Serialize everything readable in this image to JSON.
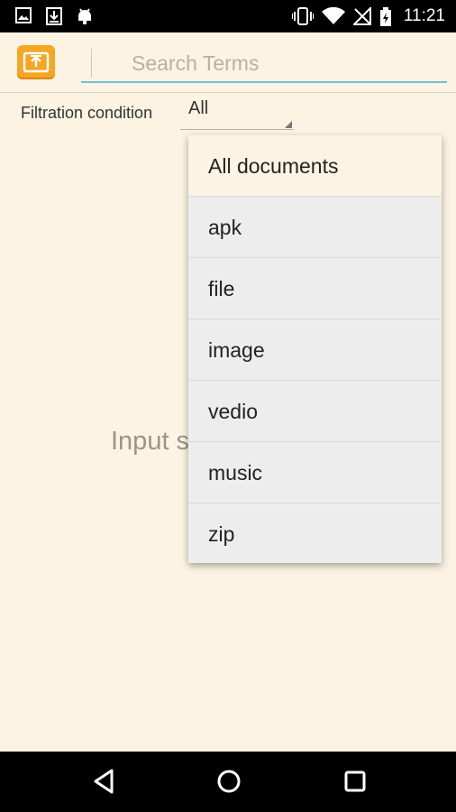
{
  "status_bar": {
    "time": "11:21",
    "left_icons": [
      "image-icon",
      "download-icon",
      "android-debug-icon"
    ],
    "right_icons": [
      "vibrate-icon",
      "wifi-icon",
      "no-signal-icon",
      "battery-charging-icon"
    ]
  },
  "toolbar": {
    "app_icon": "folder-upload-icon",
    "search": {
      "placeholder": "Search Terms",
      "value": ""
    }
  },
  "filter": {
    "label": "Filtration condition",
    "selected": "All"
  },
  "empty_hint": "Input s",
  "dropdown": {
    "items": [
      {
        "label": "All documents",
        "selected": true
      },
      {
        "label": "apk",
        "selected": false
      },
      {
        "label": "file",
        "selected": false
      },
      {
        "label": "image",
        "selected": false
      },
      {
        "label": "vedio",
        "selected": false
      },
      {
        "label": "music",
        "selected": false
      },
      {
        "label": "zip",
        "selected": false
      }
    ]
  },
  "nav_bar": {
    "buttons": [
      "back-icon",
      "home-icon",
      "recents-icon"
    ]
  },
  "colors": {
    "background": "#FCF3E2",
    "accent": "#6FC2D6",
    "app_icon": "#F5A623"
  }
}
